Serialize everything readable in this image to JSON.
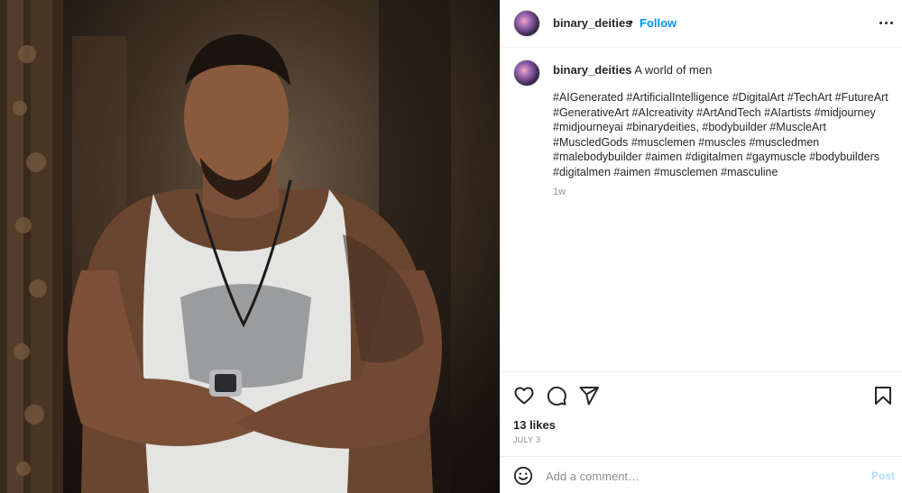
{
  "post": {
    "username": "binary_deities",
    "follow_label": "Follow",
    "separator": "•",
    "caption_text": "A world of men",
    "hashtags": "#AIGenerated #ArtificialIntelligence #DigitalArt #TechArt #FutureArt #GenerativeArt #AIcreativity #ArtAndTech #AIartists #midjourney #midjourneyai #binarydeities, #bodybuilder #MuscleArt #MuscledGods #musclemen #muscles #muscledmen #malebodybuilder #aimen #digitalmen #gaymuscle #bodybuilders #digitalmen #aimen #musclemen #masculine",
    "time_ago": "1w",
    "likes": "13 likes",
    "date": "JULY 3"
  },
  "comment": {
    "placeholder": "Add a comment…",
    "post_label": "Post"
  },
  "icons": {
    "more": "more-horizontal-icon",
    "like": "heart-icon",
    "comment": "comment-bubble-icon",
    "share": "paper-plane-icon",
    "save": "bookmark-icon",
    "emoji": "smiley-icon"
  },
  "colors": {
    "accent": "#0095f6",
    "post_disabled": "#b3dbff",
    "muted": "#8e8e8e",
    "text": "#262626"
  }
}
